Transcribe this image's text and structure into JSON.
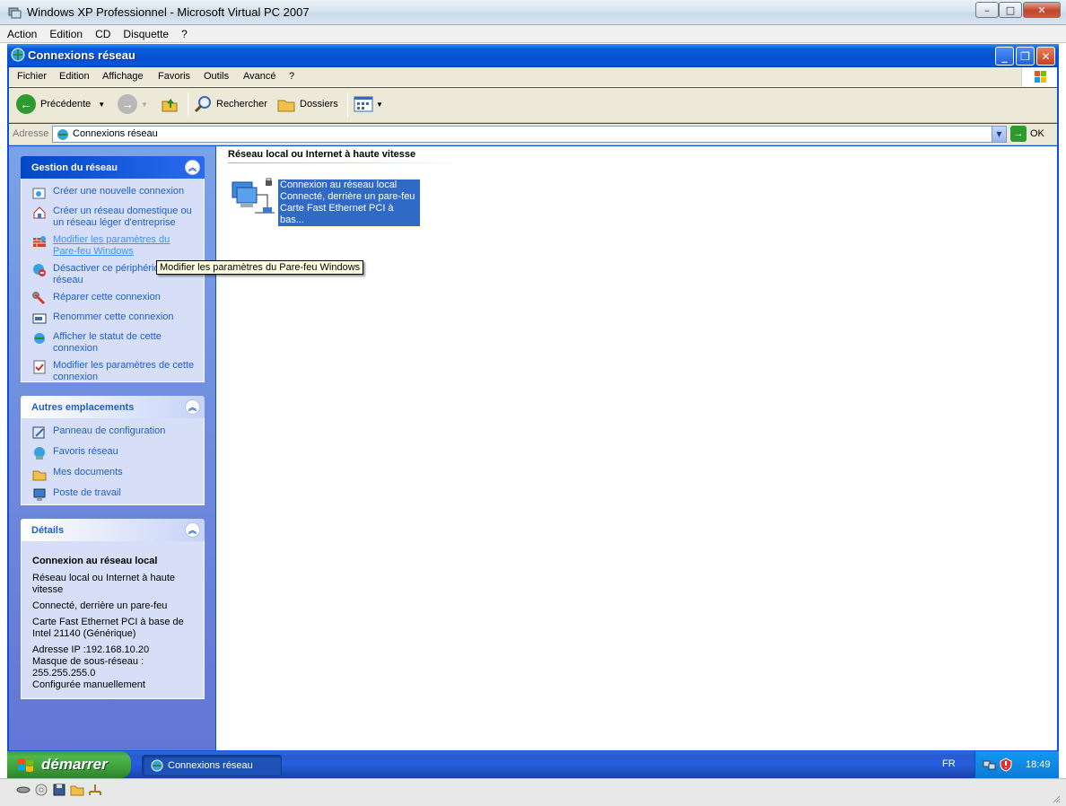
{
  "host": {
    "title": "Windows XP Professionnel - Microsoft Virtual PC 2007",
    "menu": [
      "Action",
      "Edition",
      "CD",
      "Disquette",
      "?"
    ]
  },
  "window": {
    "title": "Connexions réseau",
    "menu": [
      "Fichier",
      "Edition",
      "Affichage",
      "Favoris",
      "Outils",
      "Avancé",
      "?"
    ],
    "toolbar": {
      "back": "Précédente",
      "search": "Rechercher",
      "folders": "Dossiers"
    },
    "address": {
      "label": "Adresse",
      "value": "Connexions réseau",
      "go": "OK"
    }
  },
  "sidebar": {
    "network_tasks": {
      "title": "Gestion du réseau",
      "items": [
        {
          "label": "Créer une nouvelle connexion",
          "icon": "new-connection-icon"
        },
        {
          "label": "Créer un réseau domestique ou un réseau léger d'entreprise",
          "icon": "home-network-icon"
        },
        {
          "label": "Modifier les paramètres du Pare-feu Windows",
          "icon": "firewall-icon"
        },
        {
          "label": "Désactiver ce périphérique réseau",
          "icon": "disable-device-icon"
        },
        {
          "label": "Réparer cette connexion",
          "icon": "repair-icon"
        },
        {
          "label": "Renommer cette connexion",
          "icon": "rename-icon"
        },
        {
          "label": "Afficher le statut de cette connexion",
          "icon": "status-icon"
        },
        {
          "label": "Modifier les paramètres de cette connexion",
          "icon": "settings-icon"
        }
      ]
    },
    "other_places": {
      "title": "Autres emplacements",
      "items": [
        {
          "label": "Panneau de configuration",
          "icon": "control-panel-icon"
        },
        {
          "label": "Favoris réseau",
          "icon": "network-places-icon"
        },
        {
          "label": "Mes documents",
          "icon": "my-documents-icon"
        },
        {
          "label": "Poste de travail",
          "icon": "my-computer-icon"
        }
      ]
    },
    "details": {
      "title": "Détails",
      "name": "Connexion au réseau local",
      "lines": [
        "Réseau local ou Internet à haute vitesse",
        "Connecté, derrière un pare-feu",
        "Carte Fast Ethernet PCI à base de Intel 21140 (Générique)",
        "Adresse IP :192.168.10.20",
        "Masque de sous-réseau : 255.255.255.0",
        "Configurée manuellement"
      ]
    }
  },
  "content": {
    "group_title": "Réseau local ou Internet à haute vitesse",
    "connection": {
      "name": "Connexion au réseau local",
      "status": "Connecté, derrière un pare-feu",
      "device": "Carte Fast Ethernet PCI à bas..."
    }
  },
  "tooltip": "Modifier les paramètres du Pare-feu Windows",
  "taskbar": {
    "start": "démarrer",
    "task": "Connexions réseau",
    "lang": "FR",
    "clock": "18:49"
  },
  "colors": {
    "xp_title_blue": "#0a5ed7",
    "sidebar_link": "#215dc6",
    "selection": "#316ac5",
    "start_green": "#3a9a37"
  }
}
